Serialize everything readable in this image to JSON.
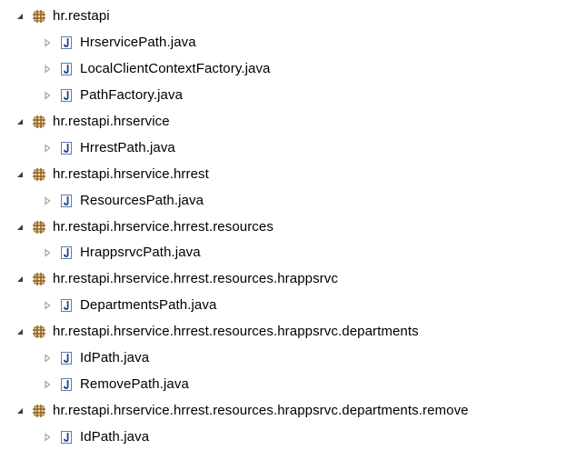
{
  "tree": [
    {
      "package": "hr.restapi",
      "files": [
        "HrservicePath.java",
        "LocalClientContextFactory.java",
        "PathFactory.java"
      ]
    },
    {
      "package": "hr.restapi.hrservice",
      "files": [
        "HrrestPath.java"
      ]
    },
    {
      "package": "hr.restapi.hrservice.hrrest",
      "files": [
        "ResourcesPath.java"
      ]
    },
    {
      "package": "hr.restapi.hrservice.hrrest.resources",
      "files": [
        "HrappsrvcPath.java"
      ]
    },
    {
      "package": "hr.restapi.hrservice.hrrest.resources.hrappsrvc",
      "files": [
        "DepartmentsPath.java"
      ]
    },
    {
      "package": "hr.restapi.hrservice.hrrest.resources.hrappsrvc.departments",
      "files": [
        "IdPath.java",
        "RemovePath.java"
      ]
    },
    {
      "package": "hr.restapi.hrservice.hrrest.resources.hrappsrvc.departments.remove",
      "files": [
        "IdPath.java"
      ]
    }
  ],
  "icons": {
    "package": "package-icon",
    "java_file": "java-file-icon",
    "expanded": "expanded-twisty-icon",
    "collapsed": "collapsed-twisty-icon"
  },
  "colors": {
    "package_icon": "#8B5A10",
    "java_icon_border": "#5B7EB5",
    "java_icon_letter": "#1F3F8A",
    "twisty_expanded": "#3D3D3D",
    "twisty_collapsed": "#9A9A9A"
  }
}
